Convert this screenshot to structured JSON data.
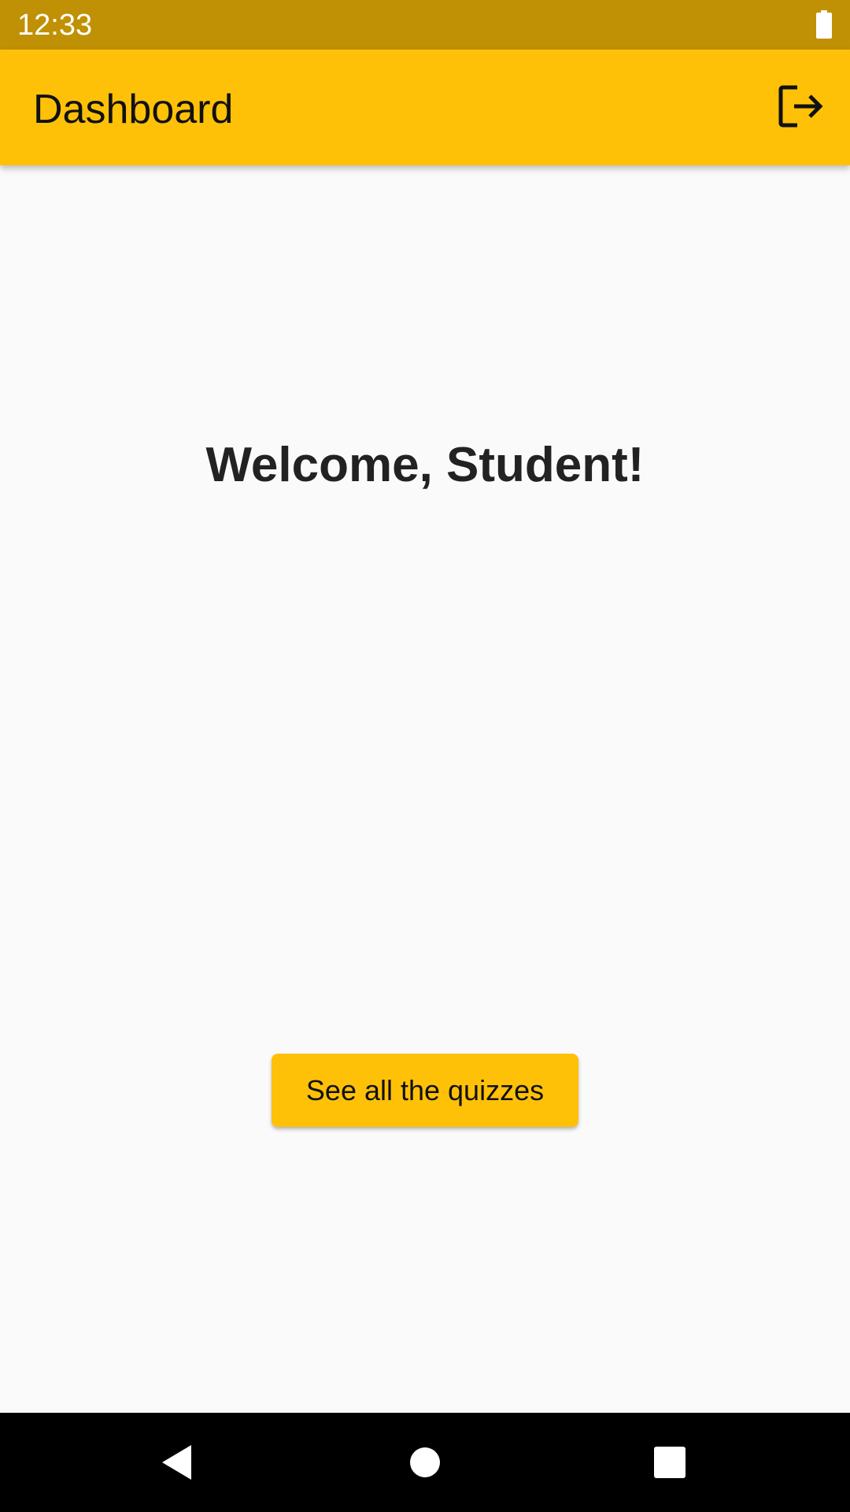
{
  "status_bar": {
    "time": "12:33",
    "battery_icon": "battery-full-icon"
  },
  "app_bar": {
    "title": "Dashboard",
    "logout_icon": "logout-icon"
  },
  "main": {
    "welcome_text": "Welcome, Student!",
    "quiz_button_label": "See all the quizzes"
  },
  "nav_bar": {
    "back_icon": "back-triangle-icon",
    "home_icon": "home-circle-icon",
    "recents_icon": "recents-square-icon"
  },
  "colors": {
    "status_bar": "#c09104",
    "app_bar": "#ffc107",
    "background": "#fafafa",
    "button": "#ffc107"
  }
}
